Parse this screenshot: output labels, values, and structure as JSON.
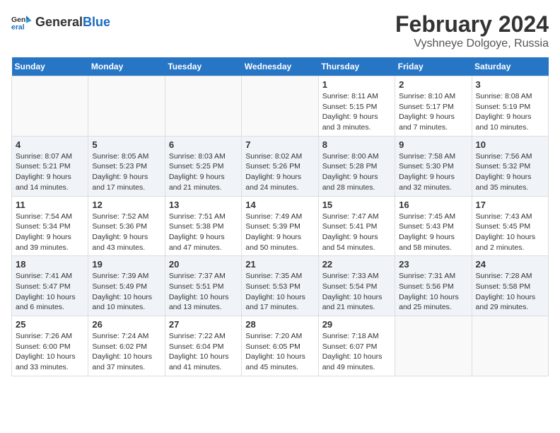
{
  "logo": {
    "general": "General",
    "blue": "Blue"
  },
  "title": "February 2024",
  "subtitle": "Vyshneye Dolgoye, Russia",
  "weekdays": [
    "Sunday",
    "Monday",
    "Tuesday",
    "Wednesday",
    "Thursday",
    "Friday",
    "Saturday"
  ],
  "weeks": [
    [
      {
        "day": "",
        "info": ""
      },
      {
        "day": "",
        "info": ""
      },
      {
        "day": "",
        "info": ""
      },
      {
        "day": "",
        "info": ""
      },
      {
        "day": "1",
        "info": "Sunrise: 8:11 AM\nSunset: 5:15 PM\nDaylight: 9 hours\nand 3 minutes."
      },
      {
        "day": "2",
        "info": "Sunrise: 8:10 AM\nSunset: 5:17 PM\nDaylight: 9 hours\nand 7 minutes."
      },
      {
        "day": "3",
        "info": "Sunrise: 8:08 AM\nSunset: 5:19 PM\nDaylight: 9 hours\nand 10 minutes."
      }
    ],
    [
      {
        "day": "4",
        "info": "Sunrise: 8:07 AM\nSunset: 5:21 PM\nDaylight: 9 hours\nand 14 minutes."
      },
      {
        "day": "5",
        "info": "Sunrise: 8:05 AM\nSunset: 5:23 PM\nDaylight: 9 hours\nand 17 minutes."
      },
      {
        "day": "6",
        "info": "Sunrise: 8:03 AM\nSunset: 5:25 PM\nDaylight: 9 hours\nand 21 minutes."
      },
      {
        "day": "7",
        "info": "Sunrise: 8:02 AM\nSunset: 5:26 PM\nDaylight: 9 hours\nand 24 minutes."
      },
      {
        "day": "8",
        "info": "Sunrise: 8:00 AM\nSunset: 5:28 PM\nDaylight: 9 hours\nand 28 minutes."
      },
      {
        "day": "9",
        "info": "Sunrise: 7:58 AM\nSunset: 5:30 PM\nDaylight: 9 hours\nand 32 minutes."
      },
      {
        "day": "10",
        "info": "Sunrise: 7:56 AM\nSunset: 5:32 PM\nDaylight: 9 hours\nand 35 minutes."
      }
    ],
    [
      {
        "day": "11",
        "info": "Sunrise: 7:54 AM\nSunset: 5:34 PM\nDaylight: 9 hours\nand 39 minutes."
      },
      {
        "day": "12",
        "info": "Sunrise: 7:52 AM\nSunset: 5:36 PM\nDaylight: 9 hours\nand 43 minutes."
      },
      {
        "day": "13",
        "info": "Sunrise: 7:51 AM\nSunset: 5:38 PM\nDaylight: 9 hours\nand 47 minutes."
      },
      {
        "day": "14",
        "info": "Sunrise: 7:49 AM\nSunset: 5:39 PM\nDaylight: 9 hours\nand 50 minutes."
      },
      {
        "day": "15",
        "info": "Sunrise: 7:47 AM\nSunset: 5:41 PM\nDaylight: 9 hours\nand 54 minutes."
      },
      {
        "day": "16",
        "info": "Sunrise: 7:45 AM\nSunset: 5:43 PM\nDaylight: 9 hours\nand 58 minutes."
      },
      {
        "day": "17",
        "info": "Sunrise: 7:43 AM\nSunset: 5:45 PM\nDaylight: 10 hours\nand 2 minutes."
      }
    ],
    [
      {
        "day": "18",
        "info": "Sunrise: 7:41 AM\nSunset: 5:47 PM\nDaylight: 10 hours\nand 6 minutes."
      },
      {
        "day": "19",
        "info": "Sunrise: 7:39 AM\nSunset: 5:49 PM\nDaylight: 10 hours\nand 10 minutes."
      },
      {
        "day": "20",
        "info": "Sunrise: 7:37 AM\nSunset: 5:51 PM\nDaylight: 10 hours\nand 13 minutes."
      },
      {
        "day": "21",
        "info": "Sunrise: 7:35 AM\nSunset: 5:53 PM\nDaylight: 10 hours\nand 17 minutes."
      },
      {
        "day": "22",
        "info": "Sunrise: 7:33 AM\nSunset: 5:54 PM\nDaylight: 10 hours\nand 21 minutes."
      },
      {
        "day": "23",
        "info": "Sunrise: 7:31 AM\nSunset: 5:56 PM\nDaylight: 10 hours\nand 25 minutes."
      },
      {
        "day": "24",
        "info": "Sunrise: 7:28 AM\nSunset: 5:58 PM\nDaylight: 10 hours\nand 29 minutes."
      }
    ],
    [
      {
        "day": "25",
        "info": "Sunrise: 7:26 AM\nSunset: 6:00 PM\nDaylight: 10 hours\nand 33 minutes."
      },
      {
        "day": "26",
        "info": "Sunrise: 7:24 AM\nSunset: 6:02 PM\nDaylight: 10 hours\nand 37 minutes."
      },
      {
        "day": "27",
        "info": "Sunrise: 7:22 AM\nSunset: 6:04 PM\nDaylight: 10 hours\nand 41 minutes."
      },
      {
        "day": "28",
        "info": "Sunrise: 7:20 AM\nSunset: 6:05 PM\nDaylight: 10 hours\nand 45 minutes."
      },
      {
        "day": "29",
        "info": "Sunrise: 7:18 AM\nSunset: 6:07 PM\nDaylight: 10 hours\nand 49 minutes."
      },
      {
        "day": "",
        "info": ""
      },
      {
        "day": "",
        "info": ""
      }
    ]
  ]
}
